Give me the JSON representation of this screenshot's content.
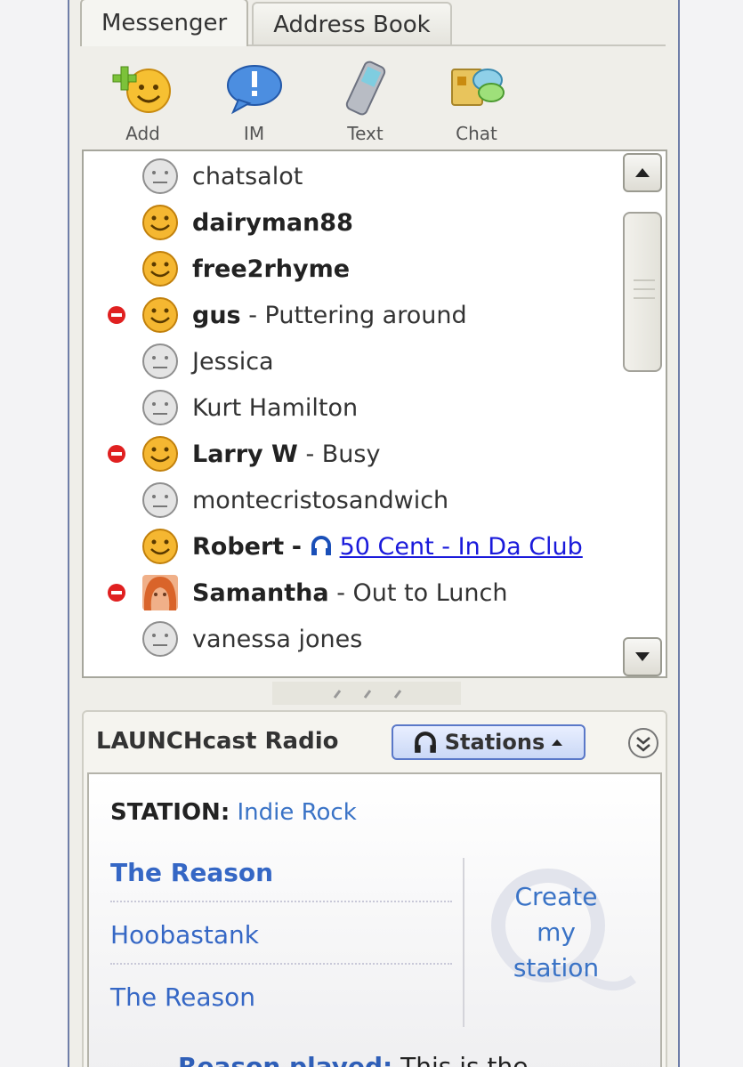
{
  "tabs": [
    {
      "label": "Messenger",
      "active": true
    },
    {
      "label": "Address Book",
      "active": false
    }
  ],
  "toolbar": [
    {
      "label": "Add",
      "icon": "add-buddy-icon"
    },
    {
      "label": "IM",
      "icon": "im-icon"
    },
    {
      "label": "Text",
      "icon": "mobile-phone-icon"
    },
    {
      "label": "Chat",
      "icon": "chat-icon"
    }
  ],
  "buddies": [
    {
      "name": "chatsalot",
      "online": false,
      "busy": false,
      "status": ""
    },
    {
      "name": "dairyman88",
      "online": true,
      "busy": false,
      "status": ""
    },
    {
      "name": "free2rhyme",
      "online": true,
      "busy": false,
      "status": ""
    },
    {
      "name": "gus",
      "online": true,
      "busy": true,
      "status": "- Puttering around"
    },
    {
      "name": "Jessica",
      "online": false,
      "busy": false,
      "status": ""
    },
    {
      "name": "Kurt Hamilton",
      "online": false,
      "busy": false,
      "status": ""
    },
    {
      "name": "Larry W",
      "online": true,
      "busy": true,
      "status": "- Busy"
    },
    {
      "name": "montecristosandwich",
      "online": false,
      "busy": false,
      "status": ""
    },
    {
      "name": "Robert",
      "online": true,
      "busy": false,
      "status": "-",
      "song": "50 Cent - In Da Club"
    },
    {
      "name": "Samantha",
      "online": true,
      "busy": true,
      "status": "- Out to Lunch",
      "avatar": true
    },
    {
      "name": "vanessa jones",
      "online": false,
      "busy": false,
      "status": ""
    }
  ],
  "radio": {
    "title": "LAUNCHcast Radio",
    "stations_label": "Stations",
    "station_label": "STATION:",
    "station_value": "Indie Rock",
    "tracks": [
      "The Reason",
      "Hoobastank",
      "The Reason"
    ],
    "create_label": [
      "Create",
      "my",
      "station"
    ],
    "footer_key": "Reason played:",
    "footer_value": "This is the"
  },
  "colors": {
    "link": "#1a1adb",
    "radio_blue": "#3567c5",
    "busy_red": "#e02020",
    "online_face": "#f5b731",
    "offline_face": "#d0d0d0"
  }
}
